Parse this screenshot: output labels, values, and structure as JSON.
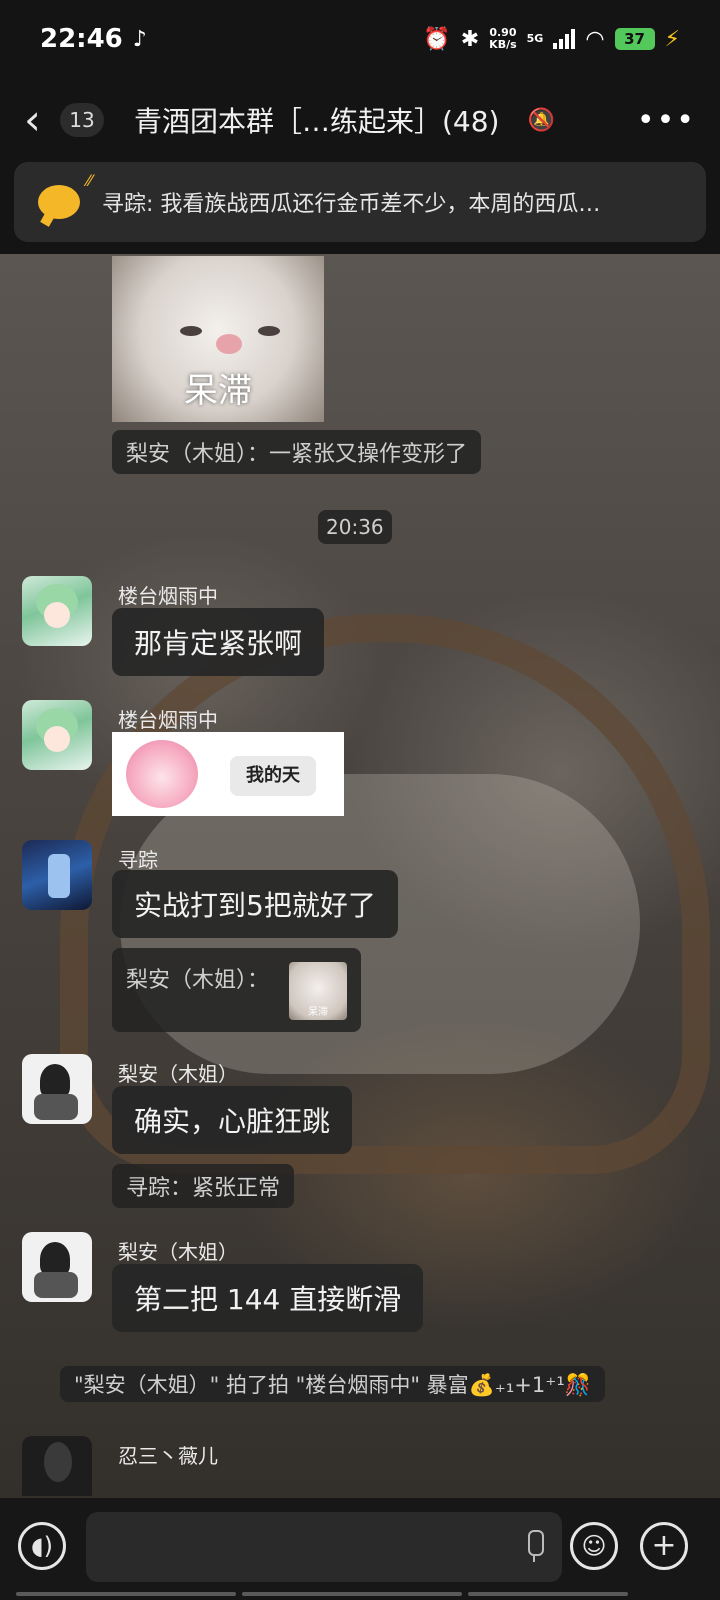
{
  "status_bar": {
    "time": "22:46",
    "net_speed_value": "0.90",
    "net_speed_unit": "KB/s",
    "network": "5G",
    "battery": "37",
    "icons": [
      "tiktok-icon",
      "alarm-icon",
      "bluetooth-icon",
      "signal-icon",
      "wifi-icon",
      "battery-icon",
      "charging-icon"
    ]
  },
  "header": {
    "unread_count": "13",
    "title": "青酒团本群［…练起来］(48)",
    "icons": [
      "back-icon",
      "mute-bell-icon",
      "more-icon"
    ]
  },
  "announcement": {
    "text": "寻踪: 我看族战西瓜还行金币差不少，本周的西瓜…"
  },
  "messages": [
    {
      "type": "sticker",
      "caption": "呆滞"
    },
    {
      "type": "reply",
      "text": "梨安（木姐）：一紧张又操作变形了"
    },
    {
      "type": "time",
      "text": "20:36"
    },
    {
      "type": "text",
      "sender": "楼台烟雨中",
      "text": "那肯定紧张啊"
    },
    {
      "type": "sticker",
      "sender": "楼台烟雨中",
      "caption": "我的天"
    },
    {
      "type": "text",
      "sender": "寻踪",
      "text": "实战打到5把就好了"
    },
    {
      "type": "reply_sticker",
      "text": "梨安（木姐）：",
      "caption": "呆滞"
    },
    {
      "type": "text",
      "sender": "梨安（木姐）",
      "text": "确实，心脏狂跳"
    },
    {
      "type": "reply",
      "text": "寻踪：紧张正常"
    },
    {
      "type": "text",
      "sender": "梨安（木姐）",
      "text": "第二把 144 直接断滑"
    },
    {
      "type": "system",
      "text": "\"梨安（木姐）\" 拍了拍 \"楼台烟雨中\" 暴富💰₊₁+1⁺¹🎊"
    },
    {
      "type": "partial",
      "sender": "忍三丶薇儿"
    }
  ],
  "input_bar": {
    "placeholder": "",
    "icons": [
      "voice-icon",
      "mic-icon",
      "emoji-icon",
      "plus-icon"
    ]
  }
}
